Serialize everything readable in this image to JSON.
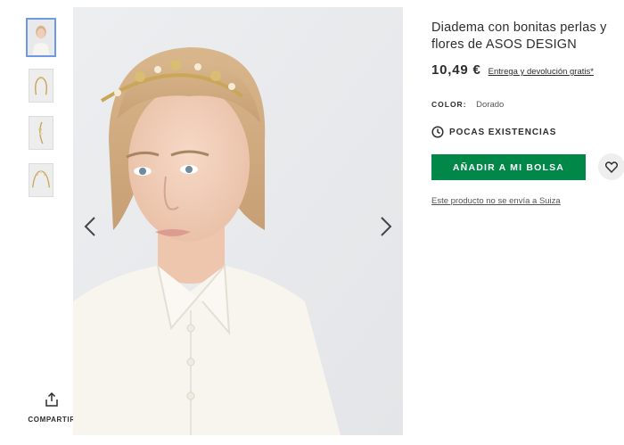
{
  "thumbnails": [
    {
      "name": "model-front",
      "active": true
    },
    {
      "name": "headband-front",
      "active": false
    },
    {
      "name": "headband-side",
      "active": false
    },
    {
      "name": "headband-detail",
      "active": false
    }
  ],
  "share": {
    "label": "COMPARTIR",
    "icon": "share-icon"
  },
  "gallery": {
    "prev_icon": "chevron-left-icon",
    "next_icon": "chevron-right-icon"
  },
  "product": {
    "title": "Diadema con bonitas perlas y flores de ASOS DESIGN",
    "price": "10,49 €",
    "delivery_link": "Entrega y devolución gratis*",
    "color_label": "COLOR:",
    "color_value": "Dorado",
    "stock_text": "POCAS EXISTENCIAS",
    "add_button": "AÑADIR A MI BOLSA",
    "shipping_note": "Este producto no se envía a Suiza"
  },
  "colors": {
    "accent": "#018849",
    "thumb_active_border": "#6d9ae3",
    "text": "#2d2d2d"
  }
}
